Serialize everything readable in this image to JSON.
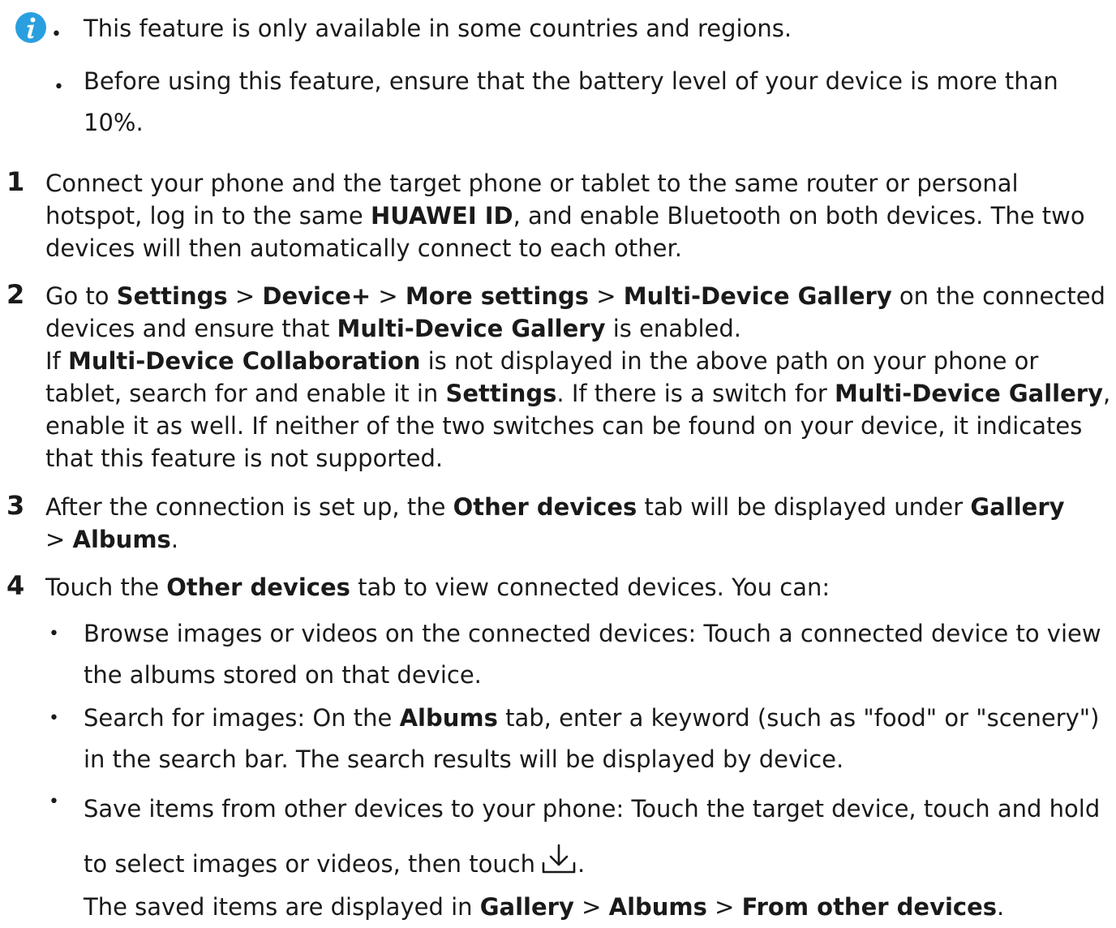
{
  "notes": [
    {
      "text": "This feature is only available in some countries and regions."
    },
    {
      "text": "Before using this feature, ensure that the battery level of your device is more than 10%."
    }
  ],
  "steps": [
    {
      "number": "1",
      "parts": [
        {
          "text": "Connect your phone and the target phone or tablet to the same router or personal hotspot, log in to the same "
        },
        {
          "text": "HUAWEI ID",
          "bold": true
        },
        {
          "text": ", and enable Bluetooth on both devices. The two devices will then automatically connect to each other."
        }
      ]
    },
    {
      "number": "2",
      "parts": [
        {
          "text": "Go to "
        },
        {
          "text": "Settings",
          "bold": true
        },
        {
          "text": " > "
        },
        {
          "text": "Device+",
          "bold": true
        },
        {
          "text": " > "
        },
        {
          "text": "More settings",
          "bold": true
        },
        {
          "text": " > "
        },
        {
          "text": "Multi-Device Gallery",
          "bold": true
        },
        {
          "text": " on the connected devices and ensure that "
        },
        {
          "text": "Multi-Device Gallery",
          "bold": true
        },
        {
          "text": " is enabled."
        },
        {
          "br": true
        },
        {
          "text": "If "
        },
        {
          "text": "Multi-Device Collaboration",
          "bold": true
        },
        {
          "text": " is not displayed in the above path on your phone or tablet, search for and enable it in "
        },
        {
          "text": "Settings",
          "bold": true
        },
        {
          "text": ". If there is a switch for "
        },
        {
          "text": "Multi-Device Gallery",
          "bold": true
        },
        {
          "text": ", enable it as well. If neither of the two switches can be found on your device, it indicates that this feature is not supported."
        }
      ]
    },
    {
      "number": "3",
      "parts": [
        {
          "text": "After the connection is set up, the "
        },
        {
          "text": "Other devices",
          "bold": true
        },
        {
          "text": " tab will be displayed under "
        },
        {
          "text": "Gallery",
          "bold": true
        },
        {
          "text": " > "
        },
        {
          "text": "Albums",
          "bold": true
        },
        {
          "text": "."
        }
      ]
    },
    {
      "number": "4",
      "parts": [
        {
          "text": "Touch the "
        },
        {
          "text": "Other devices",
          "bold": true
        },
        {
          "text": " tab to view connected devices. You can:"
        }
      ]
    }
  ],
  "step4_items": [
    {
      "parts": [
        {
          "text": "Browse images or videos on the connected devices: Touch a connected device to view the albums stored on that device."
        }
      ]
    },
    {
      "parts": [
        {
          "text": "Search for images: On the "
        },
        {
          "text": "Albums",
          "bold": true
        },
        {
          "text": " tab, enter a keyword (such as \"food\" or \"scenery\") in the search bar. The search results will be displayed by device."
        }
      ]
    },
    {
      "parts": [
        {
          "text": "Save items from other devices to your phone: Touch the target device, touch and hold to select images or videos, then touch"
        },
        {
          "icon": "download-icon"
        },
        {
          "text": "."
        }
      ]
    }
  ],
  "save_note": {
    "parts": [
      {
        "text": "The saved items are displayed in "
      },
      {
        "text": "Gallery",
        "bold": true
      },
      {
        "text": " > "
      },
      {
        "text": "Albums",
        "bold": true
      },
      {
        "text": " > "
      },
      {
        "text": "From other devices",
        "bold": true
      },
      {
        "text": "."
      }
    ]
  },
  "colors": {
    "info_icon": "#2a9fe0",
    "text": "#1a1a1a"
  }
}
